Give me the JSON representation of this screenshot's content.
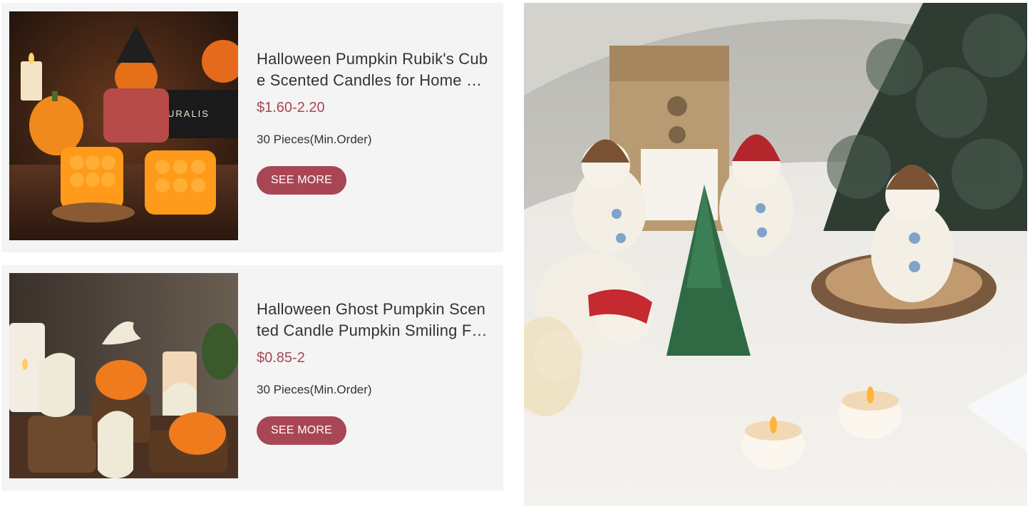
{
  "products": [
    {
      "title": "Halloween Pumpkin Rubik's Cube Scented Candles for Home Decor",
      "price": "$1.60-2.20",
      "moq": "30 Pieces(Min.Order)",
      "cta": "SEE MORE",
      "image_alt": "Pumpkin cube candles",
      "image_text": "URALIS"
    },
    {
      "title": "Halloween Ghost Pumpkin Scented Candle Pumpkin Smiling Face",
      "price": "$0.85-2",
      "moq": "30 Pieces(Min.Order)",
      "cta": "SEE MORE",
      "image_alt": "Ghost pumpkin candles"
    }
  ],
  "hero": {
    "image_alt": "Christmas snowman, polar bear and tree candles"
  },
  "colors": {
    "accent": "#a84655",
    "card_bg": "#f4f4f4",
    "text": "#333333"
  }
}
